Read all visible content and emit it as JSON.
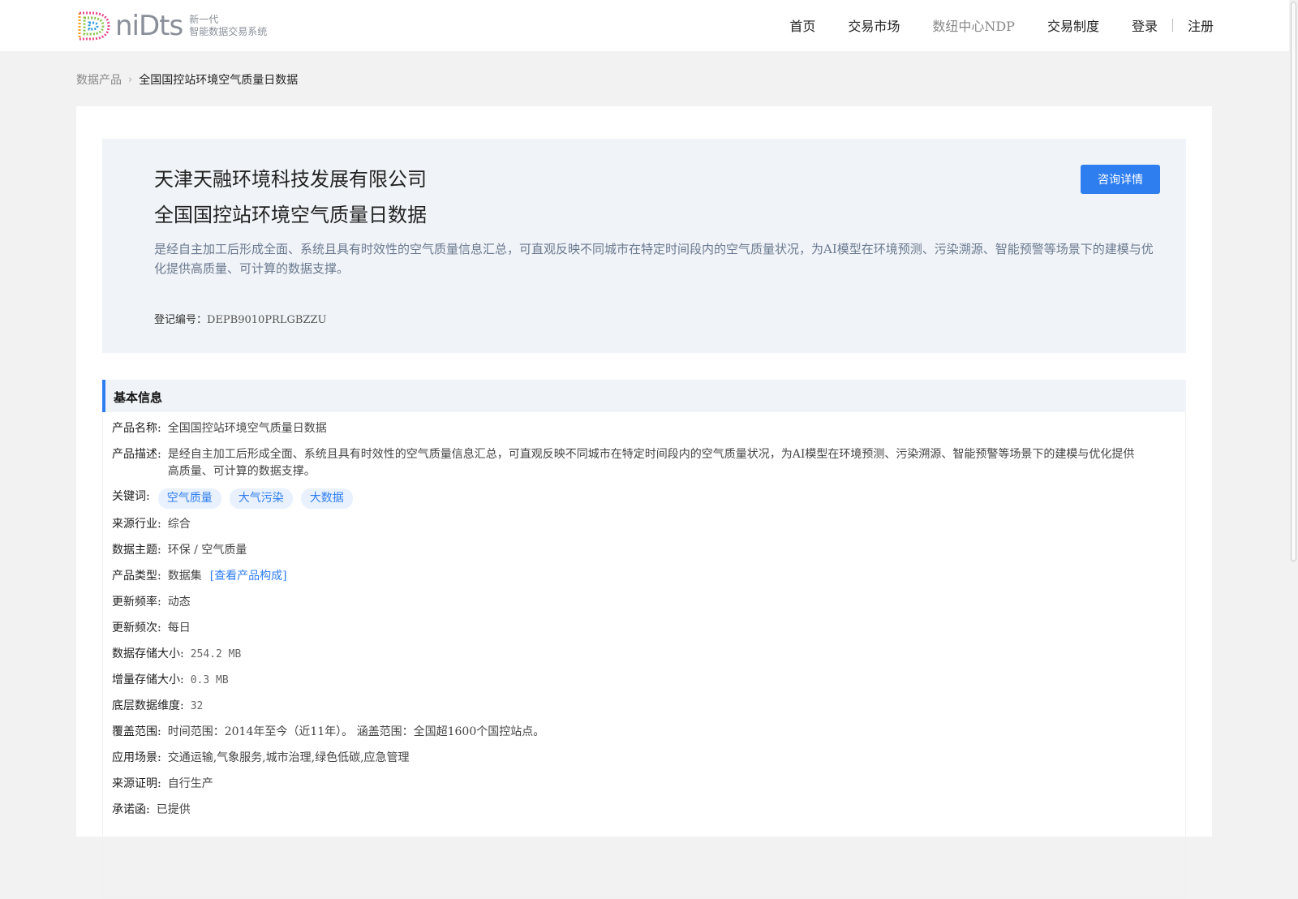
{
  "header": {
    "logo_word": "niDts",
    "logo_sub1": "新一代",
    "logo_sub2": "智能数据交易系统",
    "nav": [
      {
        "label": "首页"
      },
      {
        "label": "交易市场"
      },
      {
        "label": "数纽中心NDP"
      },
      {
        "label": "交易制度"
      }
    ],
    "login": "登录",
    "register": "注册"
  },
  "breadcrumb": {
    "parent": "数据产品",
    "current": "全国国控站环境空气质量日数据"
  },
  "hero": {
    "company": "天津天融环境科技发展有限公司",
    "title": "全国国控站环境空气质量日数据",
    "description": "是经自主加工后形成全面、系统且具有时效性的空气质量信息汇总，可直观反映不同城市在特定时间段内的空气质量状况，为AI模型在环境预测、污染溯源、智能预警等场景下的建模与优化提供高质量、可计算的数据支撑。",
    "reg_label": "登记编号：",
    "reg_value": "DEPB9010PRLGBZZU",
    "consult_button": "咨询详情"
  },
  "basic_info": {
    "section_title": "基本信息",
    "product_name_label": "产品名称:",
    "product_name": "全国国控站环境空气质量日数据",
    "product_desc_label": "产品描述:",
    "product_desc": "是经自主加工后形成全面、系统且具有时效性的空气质量信息汇总，可直观反映不同城市在特定时间段内的空气质量状况，为AI模型在环境预测、污染溯源、智能预警等场景下的建模与优化提供高质量、可计算的数据支撑。",
    "keywords_label": "关键词:",
    "keywords": [
      "空气质量",
      "大气污染",
      "大数据"
    ],
    "industry_label": "来源行业:",
    "industry": "综合",
    "theme_label": "数据主题:",
    "theme": "环保 / 空气质量",
    "type_label": "产品类型:",
    "type": "数据集",
    "type_link": "[查看产品构成]",
    "update_freq_label": "更新频率:",
    "update_freq": "动态",
    "update_times_label": "更新频次:",
    "update_times": "每日",
    "storage_label": "数据存储大小:",
    "storage": "254.2 MB",
    "incr_label": "增量存储大小:",
    "incr": "0.3 MB",
    "dim_label": "底层数据维度:",
    "dim": "32",
    "coverage_label": "覆盖范围:",
    "coverage": "时间范围：2014年至今（近11年）。 涵盖范围：全国超1600个国控站点。",
    "scenario_label": "应用场景:",
    "scenario": "交通运输,气象服务,城市治理,绿色低碳,应急管理",
    "proof_label": "来源证明:",
    "proof": "自行生产",
    "promise_label": "承诺函:",
    "promise": "已提供"
  }
}
